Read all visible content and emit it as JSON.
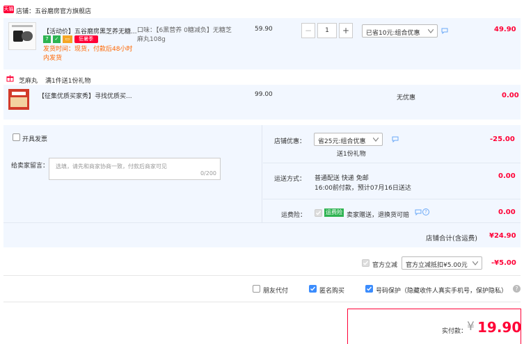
{
  "shop": {
    "badge": "天猫",
    "label": "店铺：五谷磨房官方旗舰店"
  },
  "item1": {
    "title": "【活动价】五谷磨房黑芝养无糖...",
    "badge_fire": "狂暑季",
    "shipping": "发货时间：现货，付款后48小时内发货",
    "sku": "口味：【6黑营养 0糖减负】无糖芝麻丸108g",
    "price": "59.90",
    "qty": "1",
    "minus": "−",
    "plus": "+",
    "discount_select": "已省10元:组合优惠",
    "total": "49.90"
  },
  "gift": {
    "name": "芝麻丸",
    "rule": "满1件送1份礼物"
  },
  "item2": {
    "title": "【征集优质买家秀】寻找优质买...",
    "price": "99.00",
    "discount": "无优惠",
    "total": "0.00"
  },
  "invoice": {
    "label": "开具发票"
  },
  "message": {
    "label": "给卖家留言：",
    "placeholder": "选填，请先和商家协商一致，付款后商家可见",
    "counter": "0/200"
  },
  "shop_discount": {
    "label": "店铺优惠：",
    "select": "省25元:组合优惠",
    "sub": "送1份礼物",
    "amount": "-25.00"
  },
  "delivery": {
    "label": "运送方式：",
    "method": "普通配送 快递 免邮",
    "eta": "16:00前付款，预计07月16日送达",
    "amount": "0.00"
  },
  "insurance": {
    "label": "运费险：",
    "tag": "运费险",
    "text": "卖家赠送，退换货可赔",
    "amount": "0.00"
  },
  "shop_total": {
    "label": "店铺合计(含运费)",
    "amount": "¥24.90"
  },
  "official": {
    "label": "官方立减",
    "select": "官方立减抵扣¥5.00元",
    "amount": "-¥5.00"
  },
  "options": {
    "friend_pay": "朋友代付",
    "anonymous": "匿名购买",
    "privacy": "号码保护（隐藏收件人真实手机号，保护隐私）",
    "help": "?"
  },
  "pay": {
    "label": "实付款：",
    "currency": "¥",
    "amount": "19.90"
  },
  "colors": {
    "accent": "#ff0036",
    "panel": "#f2f7ff",
    "checkbox": "#3b8cfd",
    "tag_green": "#2db351"
  }
}
